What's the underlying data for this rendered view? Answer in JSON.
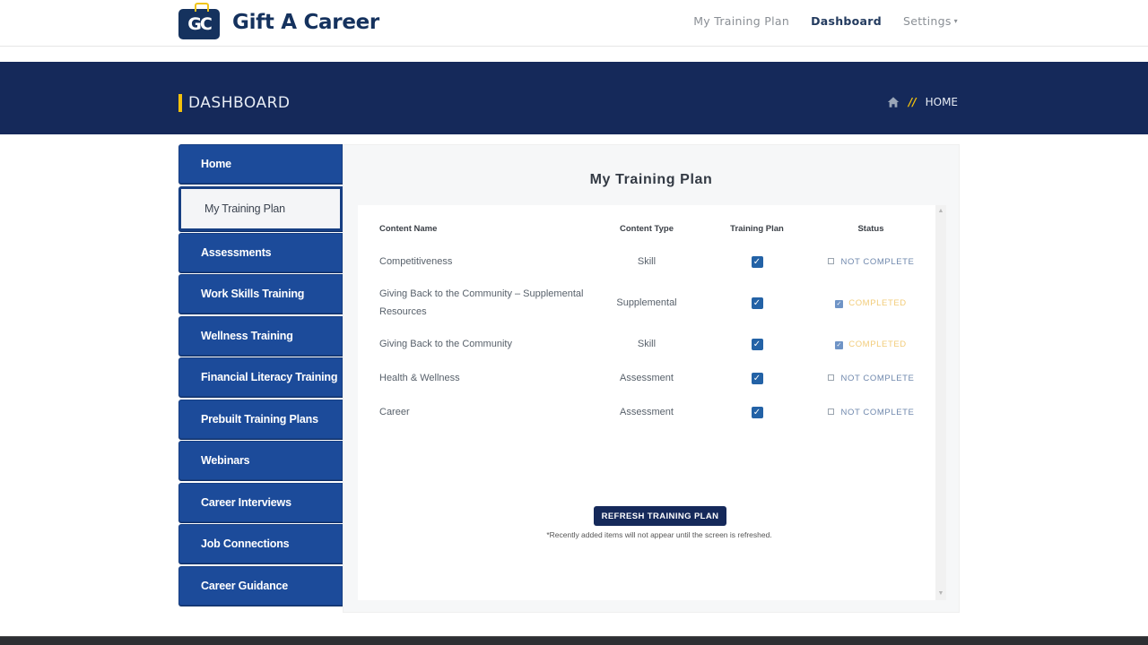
{
  "brand": {
    "badge": "GC",
    "name": "Gift A Career",
    "accent": "#f3c10d",
    "primary": "#15295a"
  },
  "nav": {
    "items": [
      {
        "label": "My Training Plan",
        "active": false
      },
      {
        "label": "Dashboard",
        "active": true
      },
      {
        "label": "Settings",
        "active": false,
        "has_dropdown": true
      }
    ],
    "caret": "⌄"
  },
  "banner": {
    "title": "DASHBOARD",
    "breadcrumb_sep": "//",
    "breadcrumb": "HOME"
  },
  "sidebar": {
    "items": [
      {
        "label": "Home"
      },
      {
        "label": "My Training Plan",
        "active": true
      },
      {
        "label": "Assessments"
      },
      {
        "label": "Work Skills Training"
      },
      {
        "label": "Wellness Training"
      },
      {
        "label": "Financial Literacy Training"
      },
      {
        "label": "Prebuilt Training Plans"
      },
      {
        "label": "Webinars"
      },
      {
        "label": "Career Interviews"
      },
      {
        "label": "Job Connections"
      },
      {
        "label": "Career Guidance"
      }
    ]
  },
  "main": {
    "title": "My Training Plan",
    "columns": [
      "Content Name",
      "Content Type",
      "Training Plan",
      "Status"
    ],
    "rows": [
      {
        "name": "Competitiveness",
        "type": "Skill",
        "in_plan": true,
        "status": "NOT COMPLETE",
        "completed": false
      },
      {
        "name": "Giving Back to the Community – Supplemental Resources",
        "type": "Supplemental",
        "in_plan": true,
        "status": "COMPLETED",
        "completed": true
      },
      {
        "name": "Giving Back to the Community",
        "type": "Skill",
        "in_plan": true,
        "status": "COMPLETED",
        "completed": true
      },
      {
        "name": "Health & Wellness",
        "type": "Assessment",
        "in_plan": true,
        "status": "NOT COMPLETE",
        "completed": false
      },
      {
        "name": "Career",
        "type": "Assessment",
        "in_plan": true,
        "status": "NOT COMPLETE",
        "completed": false
      }
    ],
    "refresh_label": "REFRESH TRAINING PLAN",
    "note": "*Recently added items will not appear until the screen is refreshed."
  }
}
